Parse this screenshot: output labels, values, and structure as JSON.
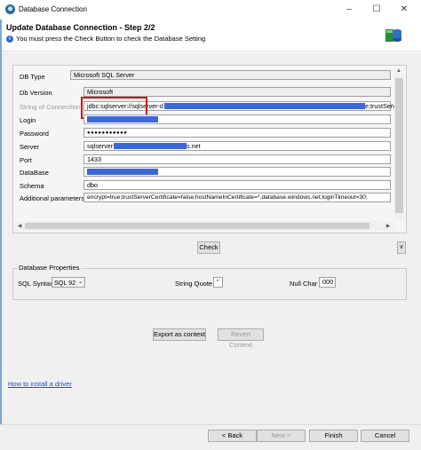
{
  "window": {
    "title": "Database Connection",
    "minimize": "–",
    "maximize": "☐",
    "close": "✕"
  },
  "header": {
    "title": "Update Database Connection - Step 2/2",
    "message": "You must press the Check Button to check the Database Setting"
  },
  "form": {
    "db_type": {
      "label": "DB Type",
      "value": "Microsoft SQL Server"
    },
    "db_version": {
      "label": "Db Version",
      "value": "Microsoft"
    },
    "connection_string": {
      "label": "String of Connection",
      "value_prefix": "jdbc:sqlserver://sqlserver-d",
      "value_suffix": "e;trustServ"
    },
    "login": {
      "label": "Login",
      "value": ""
    },
    "password": {
      "label": "Password",
      "value": "●●●●●●●●●●●"
    },
    "server": {
      "label": "Server",
      "value_prefix": "sqlserver",
      "value_suffix": "s.net"
    },
    "port": {
      "label": "Port",
      "value": "1433"
    },
    "database": {
      "label": "DataBase",
      "value": ""
    },
    "schema": {
      "label": "Schema",
      "value": "dbo"
    },
    "additional_params": {
      "label": "Additional parameters",
      "value": "encrypt=true;trustServerCertificate=false;hostNameInCertificate=*.database.windows.net;loginTimeout=30;"
    }
  },
  "check_button": "Check",
  "collapse_toggle": "v",
  "db_properties": {
    "title": "Database Properties",
    "sql_syntax_label": "SQL Syntax",
    "sql_syntax_value": "SQL 92",
    "string_quote_label": "String Quote",
    "string_quote_value": "\"",
    "null_char_label": "Null Char",
    "null_char_value": "000"
  },
  "buttons": {
    "export_as_context": "Export as context",
    "revert_context": "Revert Context",
    "back": "< Back",
    "next": "Next >",
    "finish": "Finish",
    "cancel": "Cancel"
  },
  "help_link": "How to install a driver",
  "colors": {
    "accent": "#3b68d8",
    "highlight": "#d31515",
    "link": "#1a4fd6"
  }
}
